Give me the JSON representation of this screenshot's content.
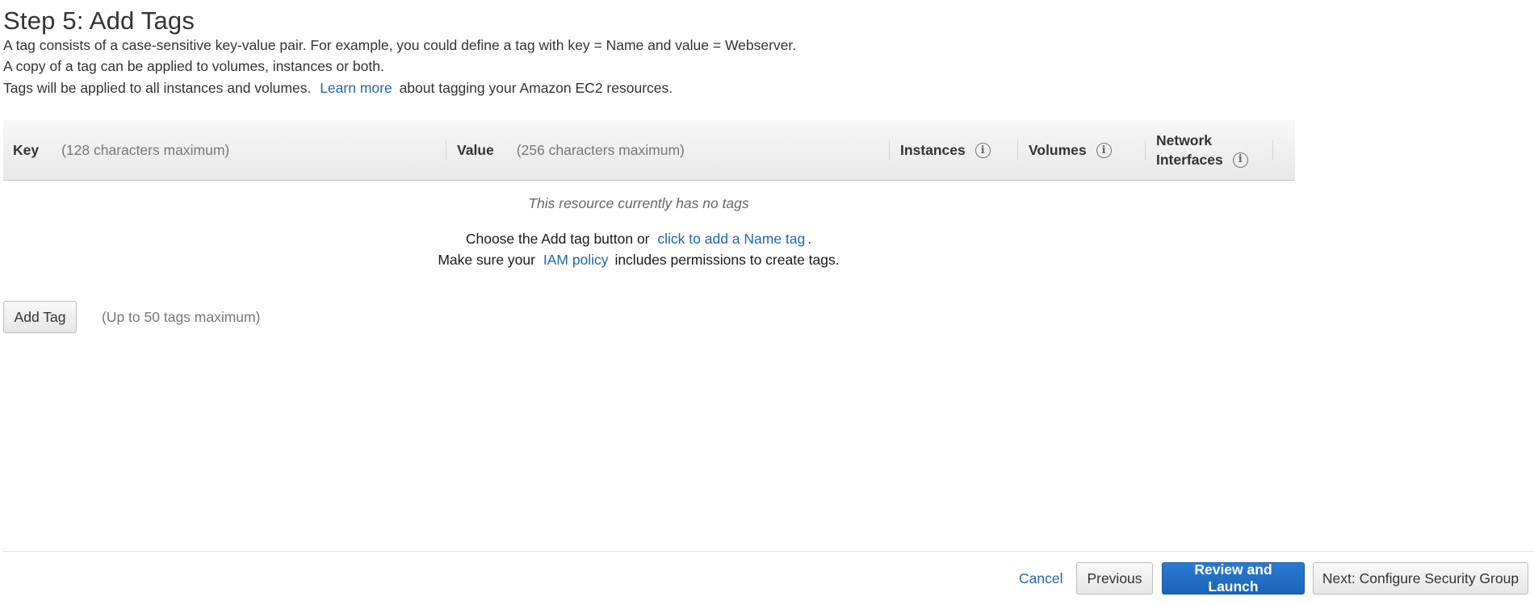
{
  "page": {
    "title": "Step 5: Add Tags",
    "desc_line1": "A tag consists of a case-sensitive key-value pair. For example, you could define a tag with key = Name and value = Webserver.",
    "desc_line2": "A copy of a tag can be applied to volumes, instances or both.",
    "desc_line3_before": "Tags will be applied to all instances and volumes.",
    "learn_more": "Learn more",
    "desc_line3_after": "about tagging your Amazon EC2 resources."
  },
  "table": {
    "key_title": "Key",
    "key_hint": "(128 characters maximum)",
    "value_title": "Value",
    "value_hint": "(256 characters maximum)",
    "instances": "Instances",
    "volumes": "Volumes",
    "eni_line1": "Network",
    "eni_line2": "Interfaces",
    "info_glyph": "i"
  },
  "empty": {
    "message": "This resource currently has no tags",
    "line1_before": "Choose the Add tag button or",
    "line1_link": "click to add a Name tag",
    "line1_after": ".",
    "line2_before": "Make sure your",
    "line2_link": "IAM policy",
    "line2_after": "includes permissions to create tags."
  },
  "add_tag": {
    "button": "Add Tag",
    "hint": "(Up to 50 tags maximum)"
  },
  "footer": {
    "cancel": "Cancel",
    "previous": "Previous",
    "review": "Review and Launch",
    "next": "Next: Configure Security Group"
  },
  "colors": {
    "link": "#2466a8",
    "primary_button": "#1b64b8"
  }
}
